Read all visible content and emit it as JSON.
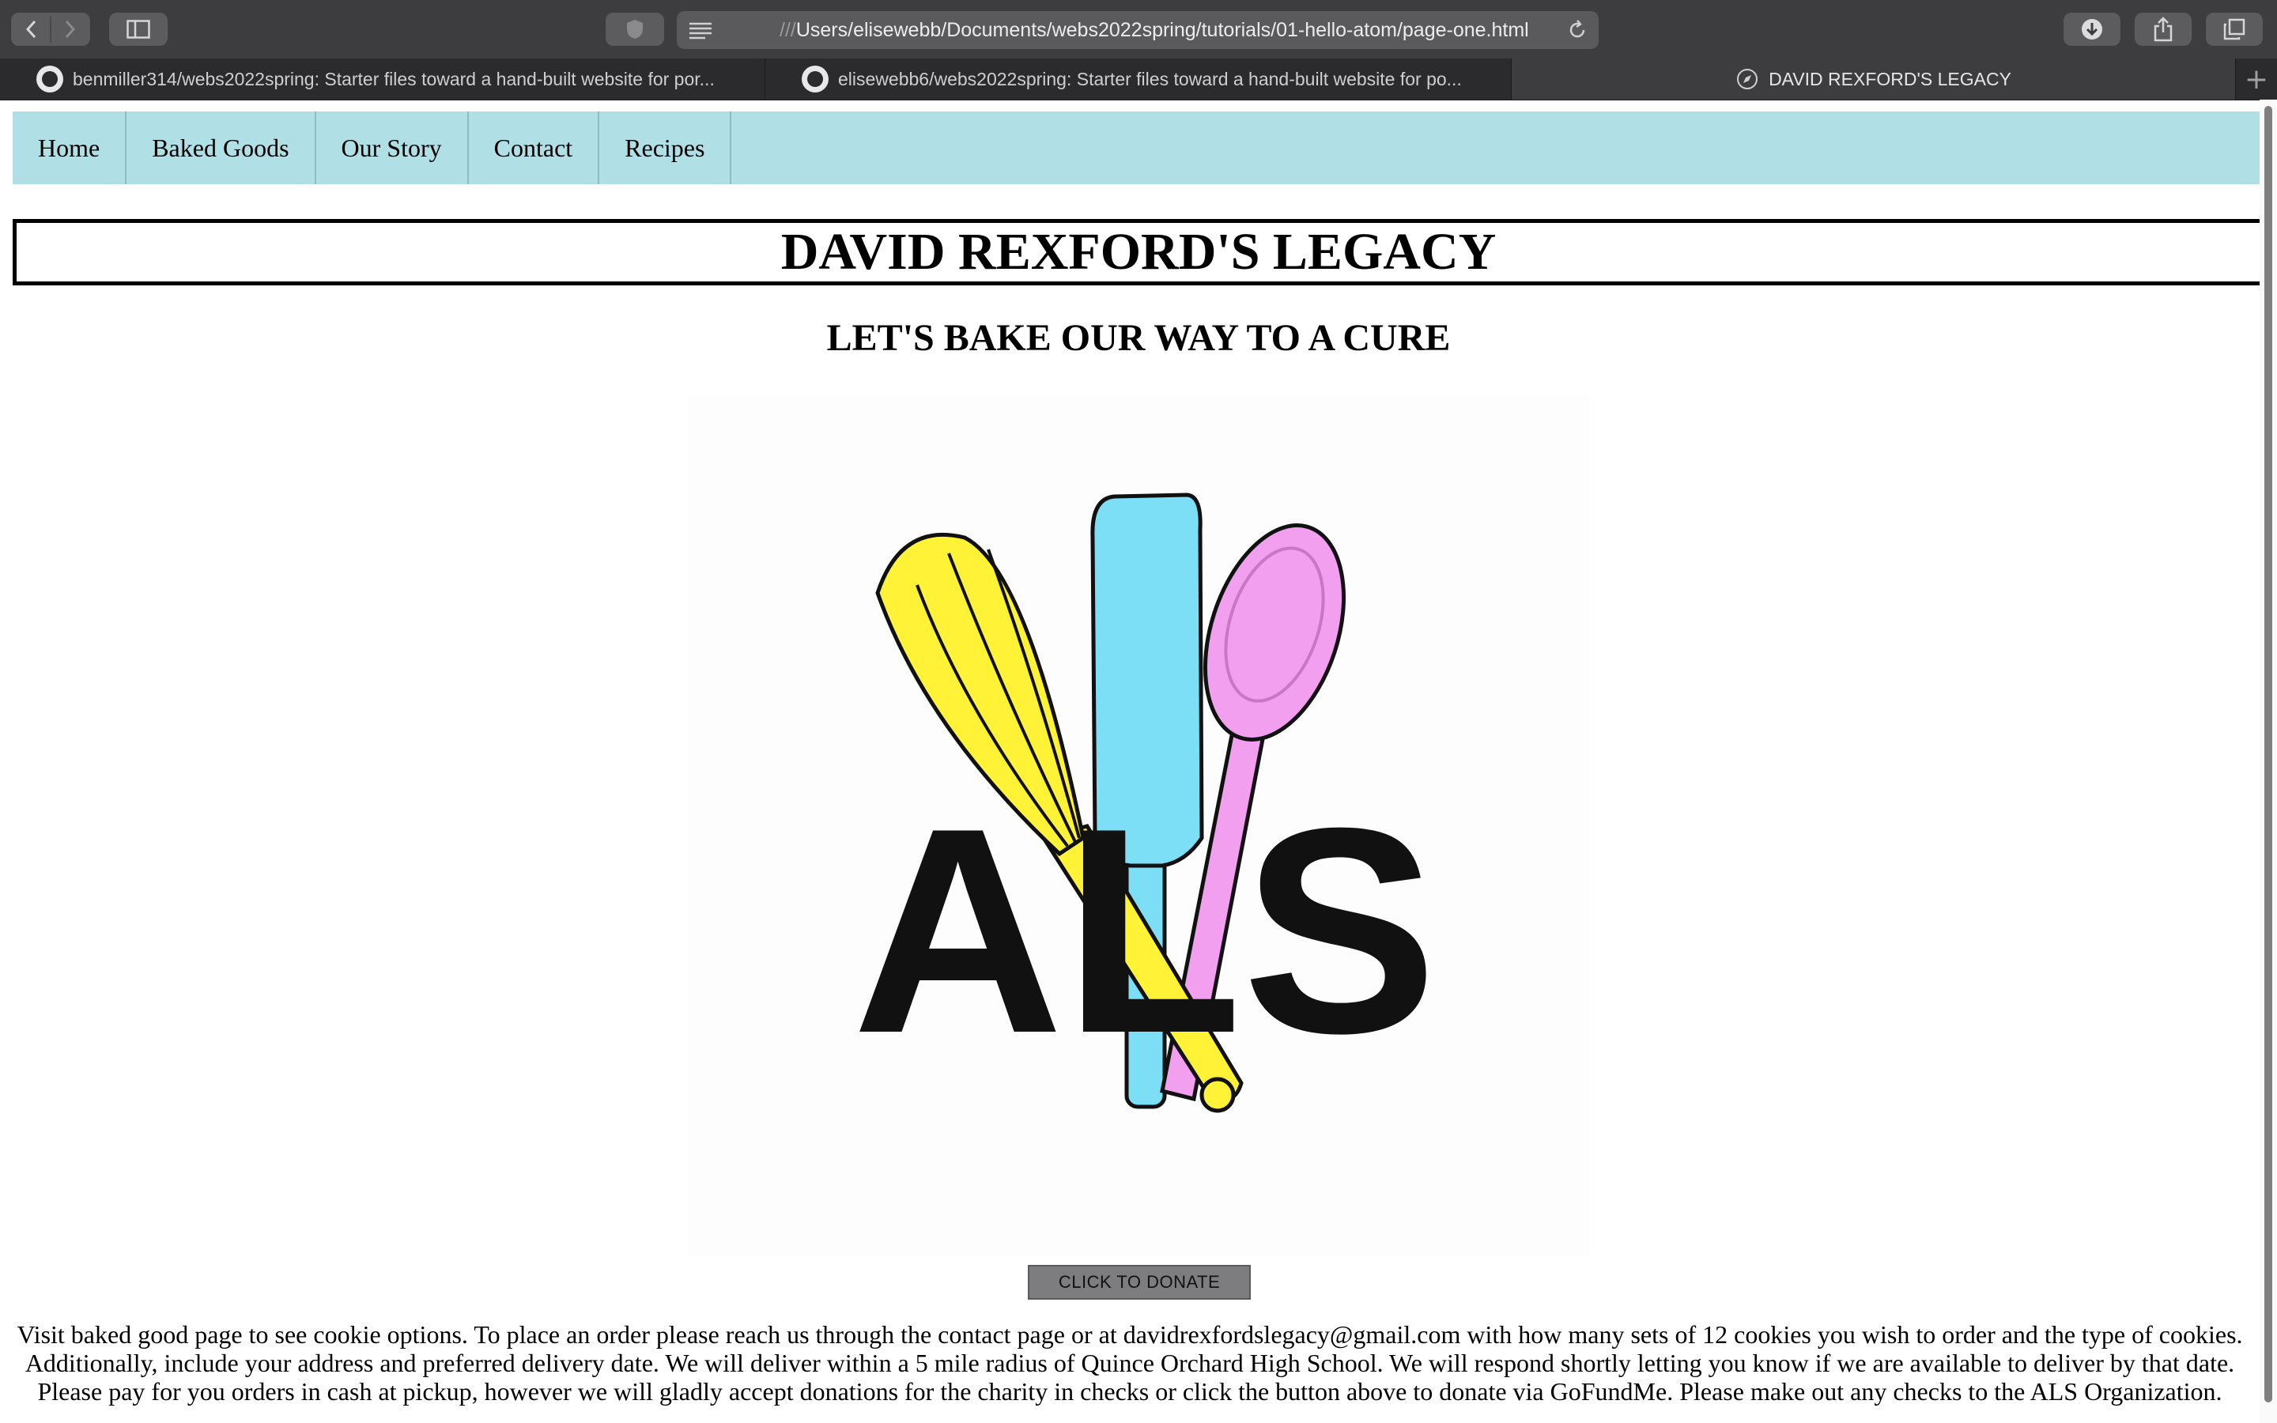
{
  "browser": {
    "url_dim": "///",
    "url": "Users/elisewebb/Documents/webs2022spring/tutorials/01-hello-atom/page-one.html",
    "tabs": [
      {
        "label": "benmiller314/webs2022spring: Starter files toward a hand-built website for por...",
        "icon": "github-icon"
      },
      {
        "label": "elisewebb6/webs2022spring: Starter files toward a hand-built website for po...",
        "icon": "github-icon"
      },
      {
        "label": "DAVID REXFORD'S LEGACY",
        "icon": "compass-icon"
      }
    ],
    "new_tab": "+"
  },
  "nav": {
    "items": [
      "Home",
      "Baked Goods",
      "Our Story",
      "Contact",
      "Recipes"
    ]
  },
  "page": {
    "title": "DAVID REXFORD'S LEGACY",
    "subtitle": "LET'S BAKE OUR WAY TO A CURE",
    "logo_text": "ALS",
    "donate_label": "CLICK TO DONATE",
    "info_lines": [
      "Visit baked good page to see cookie options. To place an order please reach us through the contact page or at davidrexfordslegacy@gmail.com with how many sets of 12 cookies you wish to order and the type of cookies.",
      "Additionally, include your address and preferred delivery date. We will deliver within a 5 mile radius of Quince Orchard High School. We will respond shortly letting you know if we are available to deliver by that date.",
      "Please pay for you orders in cash at pickup, however we will gladly accept donations for the charity in checks or click the button above to donate via GoFundMe. Please make out any checks to the ALS Organization."
    ]
  },
  "colors": {
    "nav_bg": "#b0e0e6",
    "whisk": "#fff237",
    "spatula": "#7ddff5",
    "spoon": "#f29ff0"
  }
}
